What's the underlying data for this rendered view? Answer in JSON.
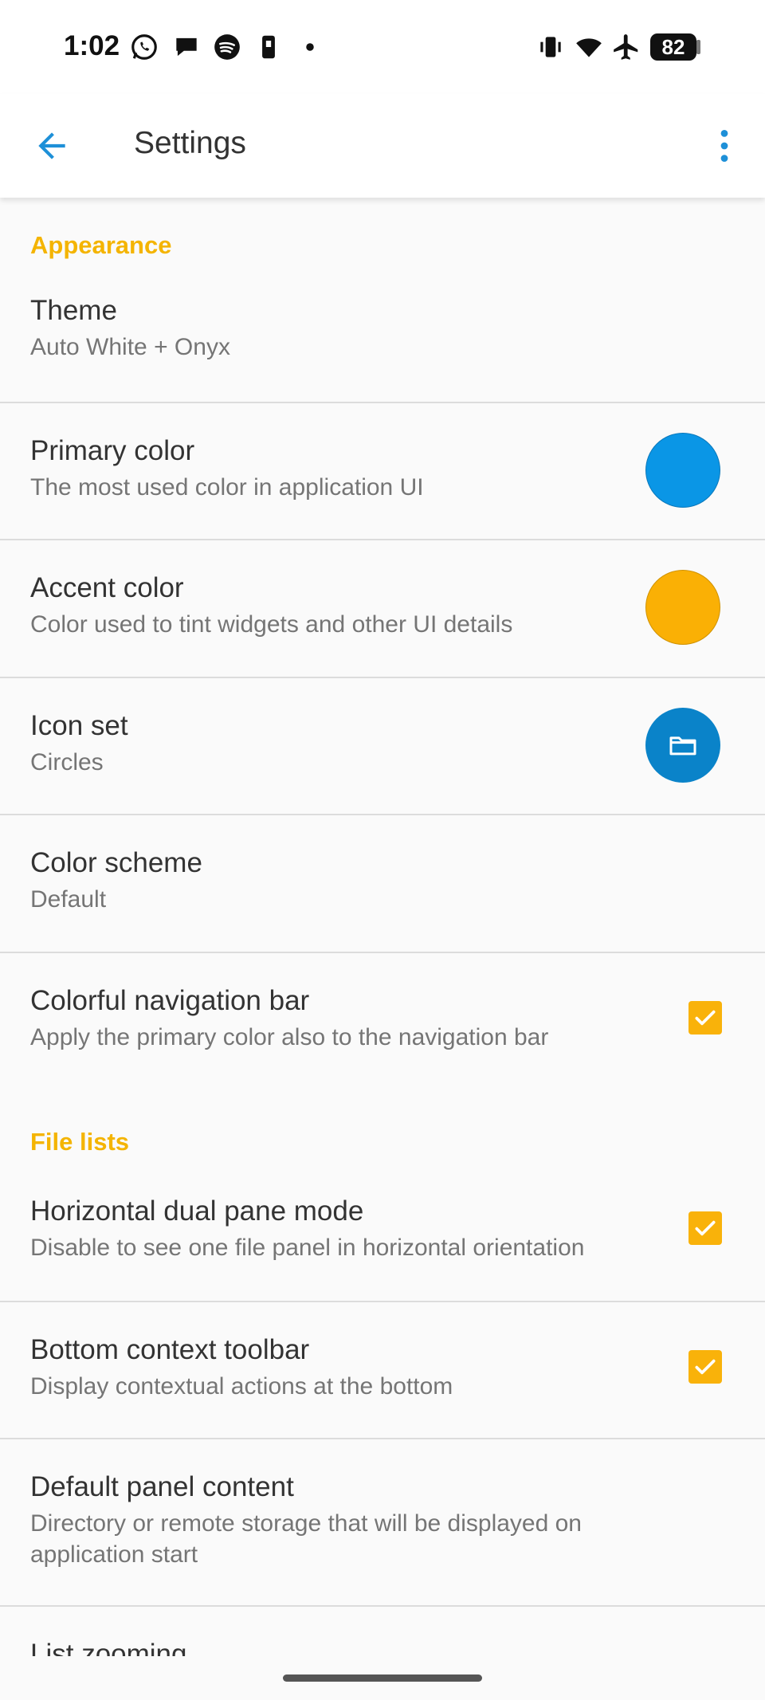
{
  "status_bar": {
    "time": "1:02",
    "battery": "82",
    "left_icons": [
      "whatsapp-icon",
      "chat-bubble-icon",
      "spotify-icon",
      "phone-app-icon",
      "dot-icon"
    ],
    "right_icons": [
      "vibrate-icon",
      "wifi-icon",
      "airplane-icon",
      "battery-icon"
    ]
  },
  "app_bar": {
    "title": "Settings",
    "back_icon": "arrow-left-icon",
    "menu_icon": "more-vert-icon"
  },
  "colors": {
    "primary": "#0a96e6",
    "accent": "#fab005",
    "section_header": "#f4b400",
    "icon_set_bg": "#0a83c9"
  },
  "sections": {
    "appearance": {
      "header": "Appearance",
      "theme": {
        "title": "Theme",
        "summary": "Auto White + Onyx"
      },
      "primary_color": {
        "title": "Primary color",
        "summary": "The most used color in application UI"
      },
      "accent_color": {
        "title": "Accent color",
        "summary": "Color used to tint widgets and other UI details"
      },
      "icon_set": {
        "title": "Icon set",
        "summary": "Circles",
        "icon": "folder-icon"
      },
      "color_scheme": {
        "title": "Color scheme",
        "summary": "Default"
      },
      "colorful_nav_bar": {
        "title": "Colorful navigation bar",
        "summary": "Apply the primary color also to the navigation bar",
        "checked": true
      }
    },
    "file_lists": {
      "header": "File lists",
      "dual_pane": {
        "title": "Horizontal dual pane mode",
        "summary": "Disable to see one file panel in horizontal orientation",
        "checked": true
      },
      "bottom_toolbar": {
        "title": "Bottom context toolbar",
        "summary": "Display contextual actions at the bottom",
        "checked": true
      },
      "default_panel": {
        "title": "Default panel content",
        "summary": "Directory or remote storage that will be displayed on application start"
      },
      "list_zooming": {
        "title": "List zooming"
      }
    }
  }
}
